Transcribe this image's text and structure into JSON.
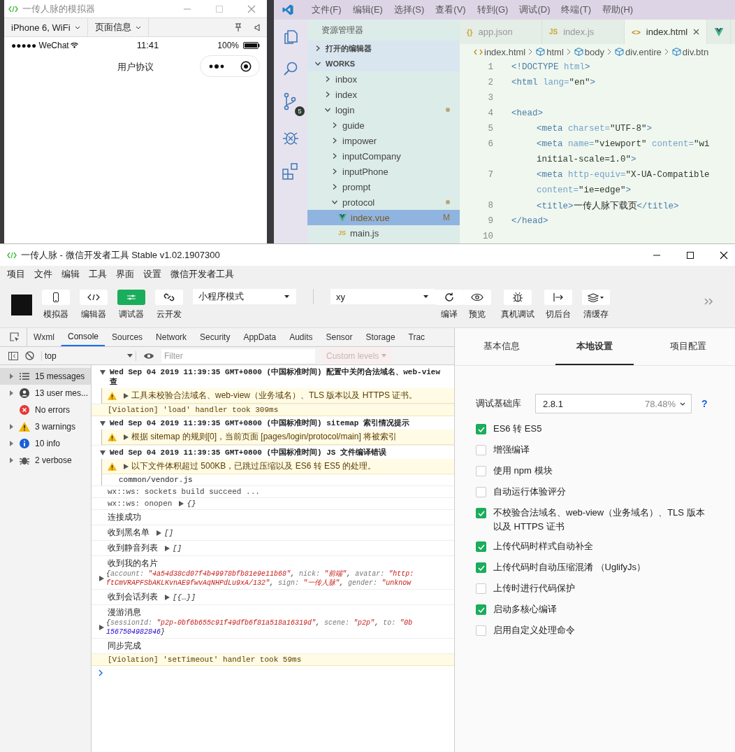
{
  "simulator": {
    "title": "一传人脉的模拟器",
    "device_menu": "iPhone 6, WiFi",
    "page_menu": "页面信息",
    "carrier": "●●●●● WeChat",
    "time": "11:41",
    "battery": "100%",
    "page_title": "用户协议"
  },
  "editor": {
    "menu": [
      "文件(F)",
      "编辑(E)",
      "选择(S)",
      "查看(V)",
      "转到(G)",
      "调试(D)",
      "终端(T)",
      "帮助(H)"
    ],
    "scm_badge": "5",
    "explorer_title": "资源管理器",
    "sections": [
      {
        "label": "打开的编辑器",
        "expanded": false
      },
      {
        "label": "WORKS",
        "expanded": true
      }
    ],
    "tree": [
      {
        "label": "inbox",
        "kind": "folder",
        "expanded": false,
        "selected": false,
        "modified": false
      },
      {
        "label": "index",
        "kind": "folder",
        "expanded": false,
        "selected": false,
        "modified": false
      },
      {
        "label": "login",
        "kind": "folder",
        "expanded": true,
        "selected": false,
        "modified": true,
        "children": [
          {
            "label": "guide",
            "kind": "folder",
            "expanded": false,
            "selected": false,
            "modified": false
          },
          {
            "label": "impower",
            "kind": "folder",
            "expanded": false,
            "selected": false,
            "modified": false
          },
          {
            "label": "inputCompany",
            "kind": "folder",
            "expanded": false,
            "selected": false,
            "modified": false
          },
          {
            "label": "inputPhone",
            "kind": "folder",
            "expanded": false,
            "selected": false,
            "modified": false
          },
          {
            "label": "prompt",
            "kind": "folder",
            "expanded": false,
            "selected": false,
            "modified": false
          },
          {
            "label": "protocol",
            "kind": "folder",
            "expanded": true,
            "selected": false,
            "modified": true,
            "children": [
              {
                "label": "index.vue",
                "kind": "vue",
                "selected": true,
                "modified": true,
                "status": "M"
              },
              {
                "label": "main.js",
                "kind": "js",
                "glyph": "JS",
                "selected": false,
                "modified": false
              }
            ]
          }
        ]
      }
    ],
    "tabs": [
      {
        "label": "app.json",
        "glyph": "{}",
        "kind": "json",
        "selected": false
      },
      {
        "label": "index.js",
        "glyph": "JS",
        "kind": "js",
        "selected": false
      },
      {
        "label": "index.html",
        "glyph": "<>",
        "kind": "html",
        "selected": true
      },
      {
        "kind": "vue",
        "selected": false
      }
    ],
    "breadcrumb": [
      {
        "label": "index.html",
        "kind": "file"
      },
      {
        "label": "html",
        "kind": "element"
      },
      {
        "label": "body",
        "kind": "element"
      },
      {
        "label": "div.entire",
        "kind": "element"
      },
      {
        "label": "div.btn",
        "kind": "element"
      }
    ],
    "code": [
      {
        "number": "1",
        "indented": false,
        "tokens": [
          {
            "kind": "tag",
            "text": "<!DOCTYPE "
          },
          {
            "kind": "attr",
            "text": "html"
          },
          {
            "kind": "tag",
            "text": ">"
          }
        ]
      },
      {
        "number": "2",
        "indented": false,
        "tokens": [
          {
            "kind": "tag",
            "text": "<html "
          },
          {
            "kind": "attr",
            "text": "lang="
          },
          {
            "kind": "str",
            "text": "\"en\""
          },
          {
            "kind": "tag",
            "text": ">"
          }
        ]
      },
      {
        "number": "3"
      },
      {
        "number": "4",
        "indented": false,
        "tokens": [
          {
            "kind": "tag",
            "text": "<head>"
          }
        ]
      },
      {
        "number": "5",
        "indented": true,
        "tokens": [
          {
            "kind": "tag",
            "text": "<meta "
          },
          {
            "kind": "attr",
            "text": "charset="
          },
          {
            "kind": "str",
            "text": "\"UTF-8\""
          },
          {
            "kind": "tag",
            "text": ">"
          }
        ]
      },
      {
        "number": "6",
        "indented": true,
        "tokens": [
          {
            "kind": "tag",
            "text": "<meta "
          },
          {
            "kind": "attr",
            "text": "name="
          },
          {
            "kind": "str",
            "text": "\"viewport\" "
          },
          {
            "kind": "attr",
            "text": "content="
          },
          {
            "kind": "str",
            "text": "\"wi"
          }
        ]
      },
      {
        "indented": true,
        "tokens": [
          {
            "kind": "str",
            "text": "initial-scale=1.0\""
          },
          {
            "kind": "tag",
            "text": ">"
          }
        ]
      },
      {
        "number": "7",
        "indented": true,
        "tokens": [
          {
            "kind": "tag",
            "text": "<meta "
          },
          {
            "kind": "attr",
            "text": "http-equiv="
          },
          {
            "kind": "str",
            "text": "\"X-UA-Compatible"
          }
        ]
      },
      {
        "indented": true,
        "tokens": [
          {
            "kind": "attr",
            "text": "content="
          },
          {
            "kind": "str",
            "text": "\"ie=edge\""
          },
          {
            "kind": "tag",
            "text": ">"
          }
        ]
      },
      {
        "number": "8",
        "indented": true,
        "tokens": [
          {
            "kind": "tag",
            "text": "<title>"
          },
          {
            "kind": "text",
            "text": "一传人脉下载页"
          },
          {
            "kind": "tag",
            "text": "</title>"
          }
        ]
      },
      {
        "number": "9",
        "indented": false,
        "tokens": [
          {
            "kind": "tag",
            "text": "</head>"
          }
        ]
      },
      {
        "number": "10"
      }
    ]
  },
  "devtools": {
    "title": "一传人脉 - 微信开发者工具 Stable v1.02.1907300",
    "menu": [
      "项目",
      "文件",
      "编辑",
      "工具",
      "界面",
      "设置",
      "微信开发者工具"
    ],
    "tools": [
      {
        "label": "模拟器",
        "selected": false
      },
      {
        "label": "编辑器",
        "selected": false
      },
      {
        "label": "调试器",
        "selected": true
      },
      {
        "label": "云开发",
        "selected": false
      }
    ],
    "mode": "小程序模式",
    "compile": "xy",
    "actions": [
      "编译",
      "预览",
      "真机调试",
      "切后台",
      "清缓存"
    ],
    "tabs": [
      {
        "label": "Wxml",
        "selected": false
      },
      {
        "label": "Console",
        "selected": true
      },
      {
        "label": "Sources",
        "selected": false
      },
      {
        "label": "Network",
        "selected": false
      },
      {
        "label": "Security",
        "selected": false
      },
      {
        "label": "AppData",
        "selected": false
      },
      {
        "label": "Audits",
        "selected": false
      },
      {
        "label": "Sensor",
        "selected": false
      },
      {
        "label": "Storage",
        "selected": false
      },
      {
        "label": "Trac",
        "selected": false
      }
    ],
    "context": "top",
    "filter_placeholder": "Filter",
    "levels": "Custom levels",
    "sidebar": [
      {
        "label": "15 messages",
        "kind": "all",
        "expandable": true,
        "selected": true
      },
      {
        "label": "13 user mes...",
        "kind": "user",
        "expandable": true,
        "selected": false
      },
      {
        "label": "No errors",
        "kind": "error",
        "expandable": false,
        "selected": false
      },
      {
        "label": "3 warnings",
        "kind": "warning",
        "expandable": true,
        "selected": false
      },
      {
        "label": "10 info",
        "kind": "info",
        "expandable": true,
        "selected": false
      },
      {
        "label": "2 verbose",
        "kind": "verbose",
        "expandable": true,
        "selected": false
      }
    ],
    "messages": [
      {
        "kind": "group",
        "expanded": true,
        "lines": [
          "Wed Sep 04 2019 11:39:35 GMT+0800 (中国标准时间) 配置中关闭合法域名、web-view",
          "查"
        ],
        "children": [
          {
            "kind": "warning",
            "text": "工具未校验合法域名、web-view（业务域名）、TLS 版本以及 HTTPS 证书。"
          }
        ]
      },
      {
        "kind": "violation",
        "text": "[Violation] 'load' handler took 309ms"
      },
      {
        "kind": "group",
        "expanded": true,
        "lines": [
          "Wed Sep 04 2019 11:39:35 GMT+0800 (中国标准时间) sitemap 索引情况提示"
        ],
        "children": [
          {
            "kind": "warning",
            "text": "根据 sitemap 的规则[0]，当前页面 [pages/login/protocol/main] 将被索引"
          }
        ]
      },
      {
        "kind": "group",
        "expanded": true,
        "lines": [
          "Wed Sep 04 2019 11:39:35 GMT+0800 (中国标准时间) JS 文件编译错误"
        ],
        "children": [
          {
            "kind": "warning",
            "text": "以下文件体积超过 500KB，已跳过压缩以及 ES6 转 ES5 的处理。"
          },
          {
            "kind": "detail",
            "text": "common/vendor.js"
          }
        ]
      },
      {
        "kind": "code",
        "text": "wx::ws: sockets build succeed ..."
      },
      {
        "kind": "code",
        "text": "wx::ws: onopen",
        "value": "{}"
      },
      {
        "kind": "log",
        "text": "连接成功"
      },
      {
        "kind": "log",
        "text": "收到黑名单",
        "value": "[]"
      },
      {
        "kind": "log",
        "text": "收到静音列表",
        "value": "[]"
      },
      {
        "kind": "log",
        "text": "收到我的名片",
        "object": [
          [
            {
              "kind": "punct",
              "text": "{"
            },
            {
              "kind": "key",
              "text": "account: "
            },
            {
              "kind": "str",
              "text": "\"4a54d38cd07f4b49978bfb81e9e11b68\""
            },
            {
              "kind": "punct",
              "text": ", "
            },
            {
              "kind": "key",
              "text": "nick: "
            },
            {
              "kind": "str",
              "text": "\"前端\""
            },
            {
              "kind": "punct",
              "text": ", "
            },
            {
              "kind": "key",
              "text": "avatar: "
            },
            {
              "kind": "str",
              "text": "\"http:"
            }
          ],
          [
            {
              "kind": "str",
              "text": "ftCmVRAPFSbAKLKvnAE9fwvAqNHPdLu9xA/132\""
            },
            {
              "kind": "punct",
              "text": ", "
            },
            {
              "kind": "key",
              "text": "sign: "
            },
            {
              "kind": "str",
              "text": "\"一传人脉\""
            },
            {
              "kind": "punct",
              "text": ", "
            },
            {
              "kind": "key",
              "text": "gender: "
            },
            {
              "kind": "str",
              "text": "\"unknow"
            }
          ]
        ]
      },
      {
        "kind": "log",
        "text": "收到会话列表",
        "value": "[{…}]"
      },
      {
        "kind": "log",
        "text": "漫游消息",
        "object": [
          [
            {
              "kind": "punct",
              "text": "{"
            },
            {
              "kind": "key",
              "text": "sessionId: "
            },
            {
              "kind": "str",
              "text": "\"p2p-0bf6b655c91f49dfb6f81a518a16319d\""
            },
            {
              "kind": "punct",
              "text": ", "
            },
            {
              "kind": "key",
              "text": "scene: "
            },
            {
              "kind": "str",
              "text": "\"p2p\""
            },
            {
              "kind": "punct",
              "text": ", "
            },
            {
              "kind": "key",
              "text": "to: "
            },
            {
              "kind": "str",
              "text": "\"0b"
            }
          ],
          [
            {
              "kind": "num",
              "text": "1567504982846"
            },
            {
              "kind": "punct",
              "text": "}"
            }
          ]
        ]
      },
      {
        "kind": "log",
        "text": "同步完成"
      },
      {
        "kind": "violation",
        "text": "[Violation] 'setTimeout' handler took 59ms"
      }
    ],
    "settings": {
      "tabs": [
        {
          "label": "基本信息",
          "selected": false
        },
        {
          "label": "本地设置",
          "selected": true
        },
        {
          "label": "项目配置",
          "selected": false
        }
      ],
      "library_label": "调试基础库",
      "library_value": "2.8.1",
      "library_usage": "78.48%",
      "help": "?",
      "options": [
        {
          "label": "ES6 转 ES5",
          "checked": true
        },
        {
          "label": "增强编译",
          "checked": false
        },
        {
          "label": "使用 npm 模块",
          "checked": false
        },
        {
          "label": "自动运行体验评分",
          "checked": false
        },
        {
          "label": "不校验合法域名、web-view（业务域名）、TLS 版本以及 HTTPS 证书",
          "checked": true
        },
        {
          "label": "上传代码时样式自动补全",
          "checked": true
        },
        {
          "label": "上传代码时自动压缩混淆 （UglifyJs）",
          "checked": true
        },
        {
          "label": "上传时进行代码保护",
          "checked": false
        },
        {
          "label": "启动多核心编译",
          "checked": true
        },
        {
          "label": "启用自定义处理命令",
          "checked": false
        }
      ]
    }
  }
}
